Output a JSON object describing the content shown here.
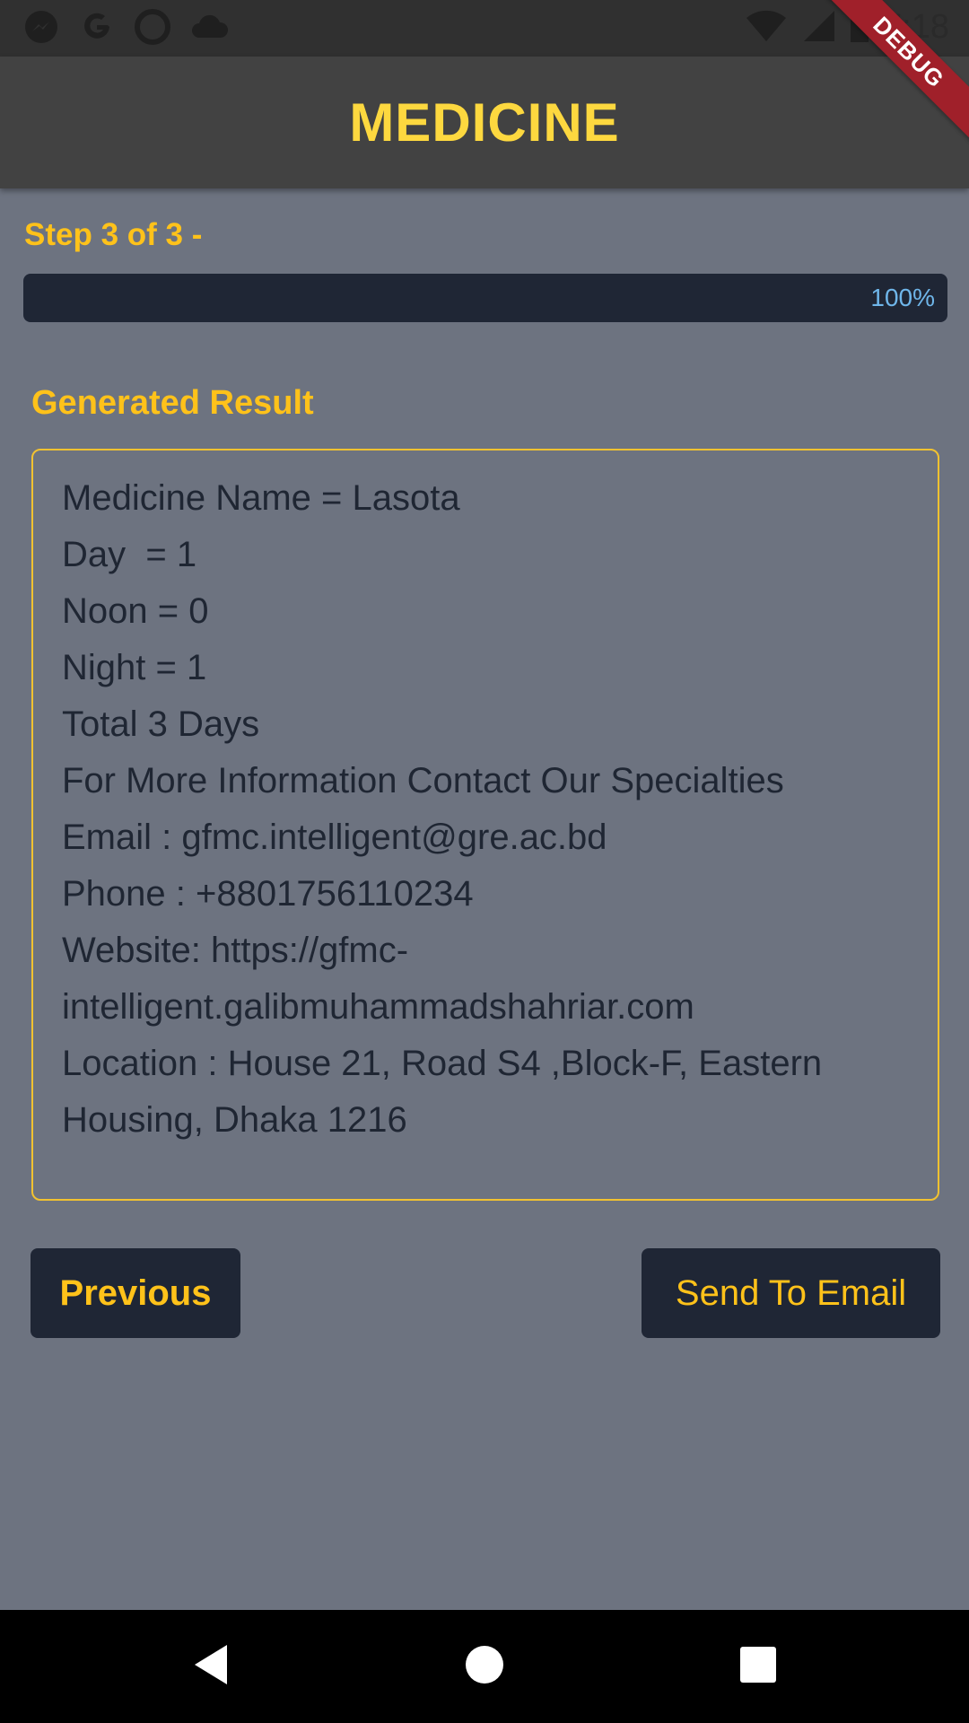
{
  "status_bar": {
    "time": "7:18",
    "left_icons": [
      "messenger-icon",
      "google-icon",
      "record-icon",
      "cloud-icon"
    ],
    "right_icons": [
      "wifi-icon",
      "signal-icon",
      "battery-icon"
    ]
  },
  "debug_banner": "DEBUG",
  "app_bar": {
    "title": "MEDICINE",
    "title_color": "#fdd83f",
    "background": "#424242"
  },
  "step": {
    "label": "Step 3 of 3 -",
    "progress_percent": 100,
    "progress_text": "100%"
  },
  "result": {
    "title": "Generated Result",
    "lines": [
      "Medicine Name = Lasota",
      "Day  = 1",
      "Noon = 0",
      "Night = 1",
      "Total 3 Days",
      "For More Information Contact Our Specialties",
      "Email : gfmc.intelligent@gre.ac.bd",
      "Phone : +8801756110234",
      "Website: https://gfmc-",
      "intelligent.galibmuhammadshahriar.com",
      "Location : House 21, Road S4 ,Block-F, Eastern",
      "Housing, Dhaka 1216"
    ]
  },
  "buttons": {
    "previous": "Previous",
    "send_email": "Send To Email"
  },
  "colors": {
    "accent": "#ffc21a",
    "page_bg": "#6d7380",
    "dark": "#1f2635"
  },
  "nav": {
    "icons": [
      "back-icon",
      "home-icon",
      "recents-icon"
    ]
  }
}
